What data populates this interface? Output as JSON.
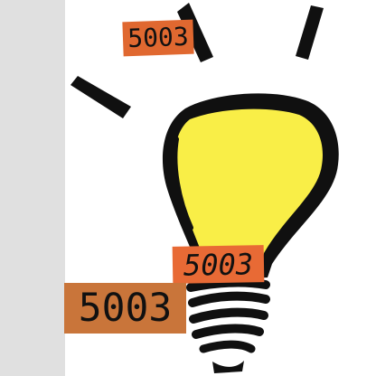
{
  "screenshot": {
    "background_color": "#ffffff",
    "left_strip_color": "#e0e0e0"
  },
  "illustration": {
    "icon": "light-bulb-icon",
    "bulb_color": "#f9ee47",
    "outline_color": "#101010",
    "ray_color": "#101010"
  },
  "labels": [
    {
      "text": "5003",
      "color": "#e06830"
    },
    {
      "text": "5003",
      "color": "#e86a35"
    },
    {
      "text": "5003",
      "color": "#c9753a"
    }
  ]
}
